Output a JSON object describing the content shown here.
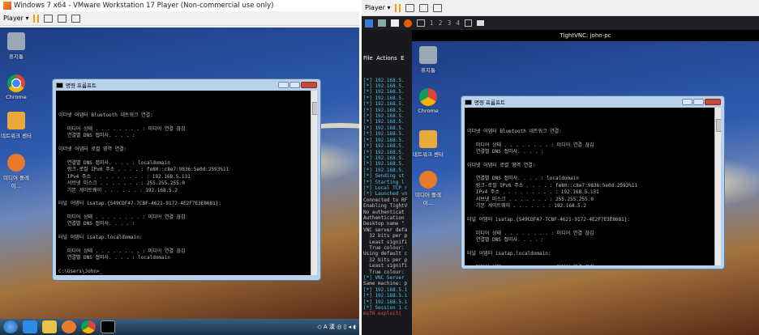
{
  "left_window": {
    "title": "Windows 7 x64 - VMware Workstation 17 Player (Non-commercial use only)",
    "player_label": "Player ▾"
  },
  "right_window": {
    "player_label": "Player ▾",
    "vnc_title": "TightVNC: john-pc",
    "workspaces": [
      "1",
      "2",
      "3",
      "4"
    ],
    "term_menu": "File  Actions  E"
  },
  "desktop_icons": [
    {
      "label": "휴지통",
      "color": "#9aa7b6"
    },
    {
      "label": "Chrome",
      "color": "#e9c347"
    },
    {
      "label": "네트워크 센터",
      "color": "#e9a83a"
    },
    {
      "label": "미디어 플레이…",
      "color": "#e87b2b"
    }
  ],
  "cmd": {
    "title": "명령 프롬프트",
    "lines": [
      "이더넷 어댑터 Bluetooth 네트워크 연결:",
      "",
      "   미디어 상태 . . . . . . . . : 미디어 연결 끊김",
      "   연결별 DNS 접미사. . . . :",
      "",
      "이더넷 어댑터 로컬 영역 연결:",
      "",
      "   연결별 DNS 접미사. . . . : localdomain",
      "   링크-로컬 IPv6 주소 . . . . : fe80::c8e7:9836:5e0d:2593%11",
      "   IPv4 주소 . . . . . . . . . : 192.168.5.131",
      "   서브넷 마스크 . . . . . . . : 255.255.255.0",
      "   기본 게이트웨이 . . . . . . : 192.168.5.2",
      "",
      "터널 어댑터 isatap.{549CDF47-7CBF-4621-9172-4E2F7E3E8681}:",
      "",
      "   미디어 상태 . . . . . . . . : 미디어 연결 끊김",
      "   연결별 DNS 접미사. . . . :",
      "",
      "터널 어댑터 isatap.localdomain:",
      "",
      "   미디어 상태 . . . . . . . . : 미디어 연결 끊김",
      "   연결별 DNS 접미사. . . . : localdomain",
      "",
      "C:\\Users\\John>_"
    ]
  },
  "kali_term": {
    "lines": [
      {
        "t": "[*] 192.168.5.",
        "c": "ok"
      },
      {
        "t": "[*] 192.168.5.",
        "c": "ok"
      },
      {
        "t": "[*] 192.168.5.",
        "c": "ok"
      },
      {
        "t": "[*] 192.168.5.",
        "c": "ok"
      },
      {
        "t": "[*] 192.168.5.",
        "c": "ok"
      },
      {
        "t": "[*] 192.168.5.",
        "c": "ok"
      },
      {
        "t": "[*] 192.168.5.",
        "c": "ok"
      },
      {
        "t": "[*] 192.168.5.",
        "c": "ok"
      },
      {
        "t": "[*] 192.168.5.",
        "c": "ok"
      },
      {
        "t": "[*] 192.168.5.",
        "c": "ok"
      },
      {
        "t": "[*] 192.168.5.",
        "c": "ok"
      },
      {
        "t": "[*] 192.168.5.",
        "c": "ok"
      },
      {
        "t": "[*] 192.168.5.",
        "c": "ok"
      },
      {
        "t": "[*] 192.168.5.",
        "c": "ok"
      },
      {
        "t": "[*] 192.168.5.",
        "c": "ok"
      },
      {
        "t": "[*] 192.168.5.",
        "c": "ok"
      },
      {
        "t": "[*] Sending st",
        "c": "ok"
      },
      {
        "t": "[*] Starting l",
        "c": "ok"
      },
      {
        "t": "[*] Local TCP r",
        "c": "ok"
      },
      {
        "t": "[*] Launched vn",
        "c": "ok"
      },
      {
        "t": "Connected to RF",
        "c": ""
      },
      {
        "t": "Enabling TightV",
        "c": ""
      },
      {
        "t": "No authenticat",
        "c": ""
      },
      {
        "t": "Authentication ",
        "c": ""
      },
      {
        "t": "Desktop name \"",
        "c": ""
      },
      {
        "t": "VNC server defa",
        "c": ""
      },
      {
        "t": "  32 bits per p",
        "c": ""
      },
      {
        "t": "  Least signifi",
        "c": ""
      },
      {
        "t": "  True colour: ",
        "c": ""
      },
      {
        "t": "Using default c",
        "c": ""
      },
      {
        "t": "  32 bits per p",
        "c": ""
      },
      {
        "t": "  Least signifi",
        "c": ""
      },
      {
        "t": "  True colour: ",
        "c": ""
      },
      {
        "t": "[*] VNC Server ",
        "c": "ok"
      },
      {
        "t": "Same machine: p",
        "c": ""
      },
      {
        "t": "[*] 192.168.5.1",
        "c": "ok"
      },
      {
        "t": "[*] 192.168.5.1",
        "c": "ok"
      },
      {
        "t": "[*] 192.168.5.1",
        "c": "ok"
      },
      {
        "t": "[*] Session 1 c",
        "c": "ok"
      },
      {
        "t": "msf6 exploit(",
        "c": "red"
      }
    ]
  }
}
